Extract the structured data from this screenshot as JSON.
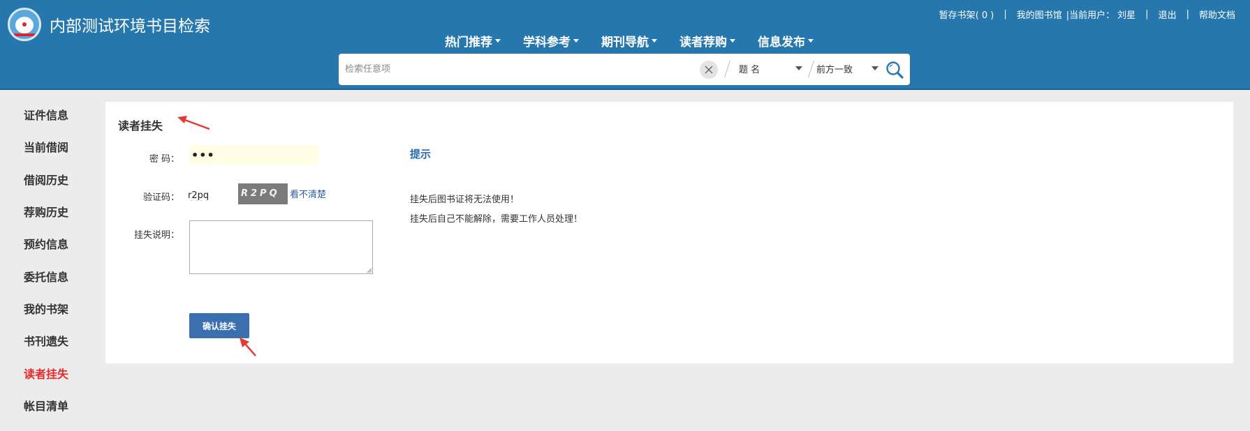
{
  "header": {
    "title": "内部测试环境书目检索",
    "bookshelf_label": "暂存书架",
    "bookshelf_count": "( 0 )",
    "my_library": "我的图书馆",
    "current_user_label": "|当前用户：",
    "current_user_name": "刘星",
    "logout": "退出",
    "help": "帮助文档",
    "separator": "|"
  },
  "nav": {
    "items": [
      {
        "label": "热门推荐"
      },
      {
        "label": "学科参考"
      },
      {
        "label": "期刊导航"
      },
      {
        "label": "读者荐购"
      },
      {
        "label": "信息发布"
      }
    ]
  },
  "search": {
    "placeholder": "检索任意项",
    "field_select": "题  名",
    "match_select": "前方一致"
  },
  "sidebar": {
    "items": [
      {
        "label": "证件信息"
      },
      {
        "label": "当前借阅"
      },
      {
        "label": "借阅历史"
      },
      {
        "label": "荐购历史"
      },
      {
        "label": "预约信息"
      },
      {
        "label": "委托信息"
      },
      {
        "label": "我的书架"
      },
      {
        "label": "书刊遗失"
      },
      {
        "label": "读者挂失"
      },
      {
        "label": "帐目清单"
      }
    ],
    "active_index": 8
  },
  "form": {
    "title": "读者挂失",
    "password_label": "密  码：",
    "password_value": "•••",
    "captcha_label": "验证码：",
    "captcha_value": "r2pq",
    "captcha_image_text": "R2PQ",
    "captcha_refresh": "看不清楚",
    "reason_label": "挂失说明：",
    "reason_value": "",
    "submit_label": "确认挂失"
  },
  "tips": {
    "title": "提示",
    "lines": [
      "挂失后图书证将无法使用！",
      "挂失后自己不能解除，需要工作人员处理！"
    ]
  },
  "colors": {
    "header_bg": "#2677ad",
    "active_sidebar": "#e42b2b",
    "button_bg": "#3b6fb0",
    "tips_title": "#2a6aab",
    "annotation_arrow": "#e53935"
  }
}
